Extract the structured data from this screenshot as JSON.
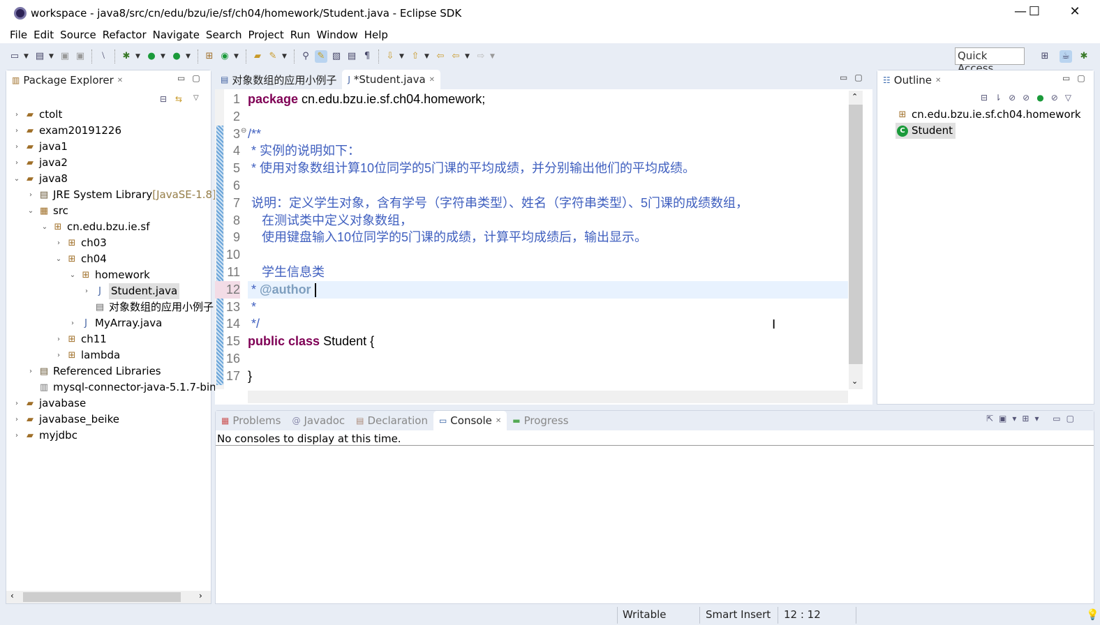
{
  "window": {
    "title": "workspace - java8/src/cn/edu/bzu/ie/sf/ch04/homework/Student.java - Eclipse SDK",
    "minimize": "—",
    "maximize": "☐",
    "close": "✕"
  },
  "menu": [
    "File",
    "Edit",
    "Source",
    "Refactor",
    "Navigate",
    "Search",
    "Project",
    "Run",
    "Window",
    "Help"
  ],
  "toolbar": {
    "quick_access": "Quick Access"
  },
  "package_explorer": {
    "title": "Package Explorer",
    "tree": [
      {
        "label": "ctolt",
        "level": 0,
        "chev": "›",
        "icon": "project-icon"
      },
      {
        "label": "exam20191226",
        "level": 0,
        "chev": "›",
        "icon": "project-icon"
      },
      {
        "label": "java1",
        "level": 0,
        "chev": "›",
        "icon": "project-icon"
      },
      {
        "label": "java2",
        "level": 0,
        "chev": "›",
        "icon": "project-icon"
      },
      {
        "label": "java8",
        "level": 0,
        "chev": "⌄",
        "icon": "project-icon"
      },
      {
        "label": "JRE System Library",
        "suffix": " [JavaSE-1.8]",
        "level": 1,
        "chev": "›",
        "icon": "library-icon"
      },
      {
        "label": "src",
        "level": 1,
        "chev": "⌄",
        "icon": "source-folder-icon"
      },
      {
        "label": "cn.edu.bzu.ie.sf",
        "level": 2,
        "chev": "⌄",
        "icon": "package-icon"
      },
      {
        "label": "ch03",
        "level": 3,
        "chev": "›",
        "icon": "package-icon"
      },
      {
        "label": "ch04",
        "level": 3,
        "chev": "⌄",
        "icon": "package-icon"
      },
      {
        "label": "homework",
        "level": 4,
        "chev": "⌄",
        "icon": "package-icon"
      },
      {
        "label": "Student.java",
        "level": 5,
        "chev": "›",
        "icon": "java-file-icon",
        "selected": true
      },
      {
        "label": "对象数组的应用小例子",
        "level": 5,
        "chev": "",
        "icon": "text-file-icon"
      },
      {
        "label": "MyArray.java",
        "level": 4,
        "chev": "›",
        "icon": "java-file-icon"
      },
      {
        "label": "ch11",
        "level": 3,
        "chev": "›",
        "icon": "package-icon"
      },
      {
        "label": "lambda",
        "level": 3,
        "chev": "›",
        "icon": "package-icon"
      },
      {
        "label": "Referenced Libraries",
        "level": 1,
        "chev": "›",
        "icon": "library-icon"
      },
      {
        "label": "mysql-connector-java-5.1.7-bin",
        "level": 1,
        "chev": "",
        "icon": "jar-icon"
      },
      {
        "label": "javabase",
        "level": 0,
        "chev": "›",
        "icon": "project-icon"
      },
      {
        "label": "javabase_beike",
        "level": 0,
        "chev": "›",
        "icon": "project-icon"
      },
      {
        "label": "myjdbc",
        "level": 0,
        "chev": "›",
        "icon": "project-icon"
      }
    ]
  },
  "editor": {
    "tabs": [
      {
        "label": "对象数组的应用小例子",
        "active": false
      },
      {
        "label": "*Student.java",
        "active": true
      }
    ],
    "lines": [
      [
        {
          "t": "package",
          "s": "kw"
        },
        {
          "t": " cn.edu.bzu.ie.sf.ch04.homework;",
          "s": ""
        }
      ],
      [],
      [
        {
          "t": "/**",
          "s": "cm"
        }
      ],
      [
        {
          "t": " * 实例的说明如下：",
          "s": "cm"
        }
      ],
      [
        {
          "t": " * 使用对象数组计算10位同学的5门课的平均成绩，并分别输出他们的平均成绩。",
          "s": "cm"
        }
      ],
      [],
      [
        {
          "t": " 说明：定义学生对象，含有学号（字符串类型）、姓名（字符串类型）、5门课的成绩数组，",
          "s": "cm"
        }
      ],
      [
        {
          "t": "    在测试类中定义对象数组，",
          "s": "cm"
        }
      ],
      [
        {
          "t": "    使用键盘输入10位同学的5门课的成绩，计算平均成绩后，输出显示。",
          "s": "cm"
        }
      ],
      [],
      [
        {
          "t": "    学生信息类",
          "s": "cm"
        }
      ],
      [
        {
          "t": " * ",
          "s": "cm"
        },
        {
          "t": "@author",
          "s": "tag"
        },
        {
          "t": " ",
          "s": ""
        }
      ],
      [
        {
          "t": " *",
          "s": "cm"
        }
      ],
      [
        {
          "t": " */",
          "s": "cm"
        }
      ],
      [
        {
          "t": "public",
          "s": "kw"
        },
        {
          "t": " ",
          "s": ""
        },
        {
          "t": "class",
          "s": "kw"
        },
        {
          "t": " Student {",
          "s": ""
        }
      ],
      [],
      [
        {
          "t": "}",
          "s": ""
        }
      ]
    ],
    "current_line": 12
  },
  "outline": {
    "title": "Outline",
    "items": [
      {
        "label": "cn.edu.bzu.ie.sf.ch04.homework",
        "icon": "package-icon"
      },
      {
        "label": "Student",
        "icon": "class-icon",
        "selected": true
      }
    ]
  },
  "bottom": {
    "tabs": [
      {
        "label": "Problems",
        "icon": "problems-icon"
      },
      {
        "label": "Javadoc",
        "icon": "at-icon"
      },
      {
        "label": "Declaration",
        "icon": "declaration-icon"
      },
      {
        "label": "Console",
        "icon": "console-icon",
        "active": true
      },
      {
        "label": "Progress",
        "icon": "progress-icon"
      }
    ],
    "console_message": "No consoles to display at this time."
  },
  "status": {
    "writable": "Writable",
    "insert_mode": "Smart Insert",
    "position": "12 : 12"
  },
  "colors": {
    "keyword": "#7f0055",
    "comment": "#3f5fbf",
    "javadoc_tag": "#7f9fbf",
    "chrome": "#e8edf5"
  }
}
